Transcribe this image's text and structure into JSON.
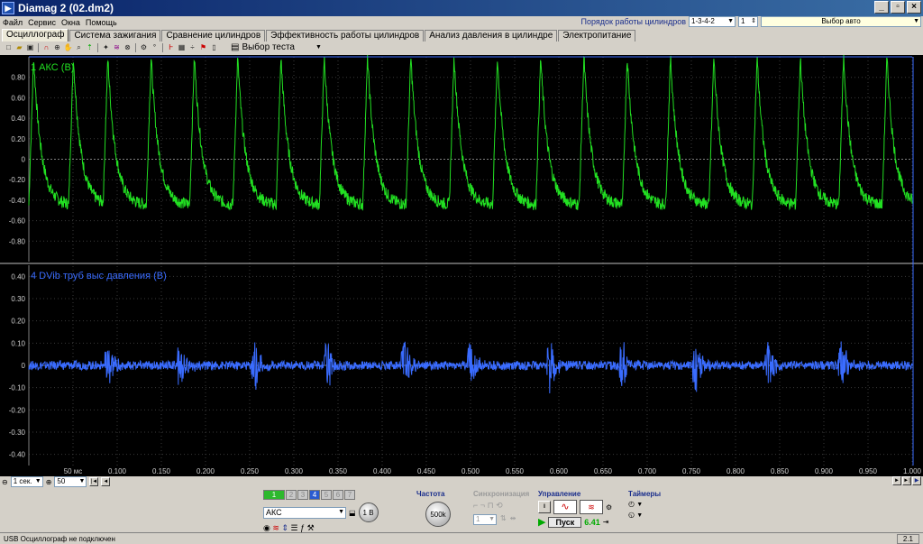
{
  "window": {
    "title": "Diamag 2 (02.dm2)"
  },
  "menu": [
    "Файл",
    "Сервис",
    "Окна",
    "Помощь"
  ],
  "header_right": {
    "firing_order_label": "Порядок работы цилиндров",
    "firing_order_value": "1-3-4-2",
    "cylinder_value": "1",
    "auto_select": "Выбор авто"
  },
  "tabs": [
    {
      "label": "Осциллограф",
      "active": true
    },
    {
      "label": "Система зажигания",
      "active": false
    },
    {
      "label": "Сравнение цилиндров",
      "active": false
    },
    {
      "label": "Эффективность работы цилиндров",
      "active": false
    },
    {
      "label": "Анализ давления в цилиндре",
      "active": false
    },
    {
      "label": "Электропитание",
      "active": false
    }
  ],
  "toolbar": {
    "test_select": "Выбор теста"
  },
  "bottom": {
    "time_select": "1 сек.",
    "zoom_value": "50"
  },
  "controls": {
    "channel_tabs": [
      "1",
      "2",
      "3",
      "4",
      "5",
      "6",
      "7"
    ],
    "channel_name": "АКС",
    "frequency_title": "Частота",
    "frequency_value": "500k",
    "sync_title": "Синхронизация",
    "sync_value": "1",
    "control_title": "Управление",
    "start_label": "Пуск",
    "counter": "6.41",
    "timers_title": "Таймеры",
    "range_value": "1 В"
  },
  "status": {
    "left": "USB Осциллограф не подключен",
    "right": "2.1"
  },
  "colors": {
    "ch1": "#22e022",
    "ch4": "#3a6cff",
    "grid": "#3a3a3a",
    "axis_text": "#d0d0d0"
  },
  "chart_data": [
    {
      "type": "line",
      "title": "1 АКС (В)",
      "ylim": [
        -1.0,
        1.0
      ],
      "yticks": [
        0.8,
        0.6,
        0.4,
        0.2,
        0,
        -0.2,
        -0.4,
        -0.6,
        -0.8
      ],
      "ytick_labels": [
        "0.80",
        "0.60",
        "0.40",
        "0.20",
        "0",
        "-0.20",
        "-0.40",
        "-0.60",
        "-0.80"
      ],
      "series": [
        {
          "waveform": "sawtooth",
          "x": [
            0.0,
            0.045,
            0.084,
            0.133,
            0.182,
            0.231,
            0.28,
            0.329,
            0.378,
            0.427,
            0.476,
            0.525,
            0.574,
            0.623,
            0.672,
            0.721,
            0.77,
            0.819,
            0.868,
            0.917,
            0.966
          ],
          "peak": 1.0,
          "trough": -0.45
        }
      ]
    },
    {
      "type": "line",
      "title": "4 DVib труб выс давления (В)",
      "ylim": [
        -0.45,
        0.45
      ],
      "yticks": [
        0.4,
        0.3,
        0.2,
        0.1,
        0,
        -0.1,
        -0.2,
        -0.3,
        -0.4
      ],
      "ytick_labels": [
        "0.40",
        "0.30",
        "0.20",
        "0.10",
        "0",
        "-0.10",
        "-0.20",
        "-0.30",
        "-0.40"
      ],
      "series": [
        {
          "waveform": "noise-bursts",
          "burst_x": [
            0.09,
            0.172,
            0.256,
            0.338,
            0.425,
            0.5,
            0.59,
            0.672,
            0.755,
            0.837,
            0.92
          ],
          "burst_amplitude": 0.12,
          "noise_amplitude": 0.02
        }
      ]
    }
  ],
  "time_axis": {
    "ticks": [
      0.05,
      0.1,
      0.15,
      0.2,
      0.25,
      0.3,
      0.35,
      0.4,
      0.45,
      0.5,
      0.55,
      0.6,
      0.65,
      0.7,
      0.75,
      0.8,
      0.85,
      0.9,
      0.95,
      1.0
    ],
    "tick_labels": [
      "50 мс",
      "0.100",
      "0.150",
      "0.200",
      "0.250",
      "0.300",
      "0.350",
      "0.400",
      "0.450",
      "0.500",
      "0.550",
      "0.600",
      "0.650",
      "0.700",
      "0.750",
      "0.800",
      "0.850",
      "0.900",
      "0.950",
      "1.000"
    ],
    "xlim": [
      0,
      1.0
    ]
  }
}
